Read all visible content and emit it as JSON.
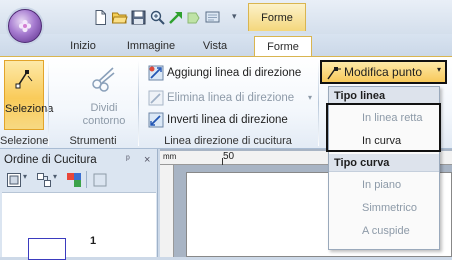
{
  "qat": {
    "app_button": "app-orb",
    "icons": [
      "new-document-icon",
      "open-folder-icon",
      "save-icon",
      "zoom-icon",
      "arrow-green-icon",
      "arrow-disabled-icon",
      "display-icon",
      "customize-qat-icon"
    ]
  },
  "context_tab_title": "Forme",
  "tabs": [
    {
      "label": "Inizio"
    },
    {
      "label": "Immagine"
    },
    {
      "label": "Vista"
    },
    {
      "label": "Forme"
    }
  ],
  "ribbon": {
    "seleziona": {
      "label": "Seleziona"
    },
    "dividi": {
      "label_line1": "Dividi",
      "label_line2": "contorno"
    },
    "direction_lines": {
      "add": "Aggiungi linea di direzione",
      "delete": "Elimina linea di direzione",
      "invert": "Inverti linea di direzione"
    },
    "modifica": {
      "label": "Modifica punto"
    },
    "groups": {
      "selezione": "Selezione",
      "strumenti": "Strumenti",
      "linea": "Linea direzione di cucitura"
    }
  },
  "menu": {
    "section1": "Tipo linea",
    "items1": [
      "In linea retta",
      "In curva"
    ],
    "section2": "Tipo curva",
    "items2": [
      "In piano",
      "Simmetrico",
      "A cuspide"
    ]
  },
  "panel": {
    "title": "Ordine di Cucitura",
    "pin": "ᵖ",
    "close": "×",
    "item_number": "1"
  },
  "ruler": {
    "unit": "mm",
    "mark": "50"
  },
  "colors": {
    "accent": "#f9cb5a",
    "accent_border": "#e2a42a",
    "ribbon_bg": "#f3f7fc",
    "disabled_text": "#8d9aa8"
  }
}
